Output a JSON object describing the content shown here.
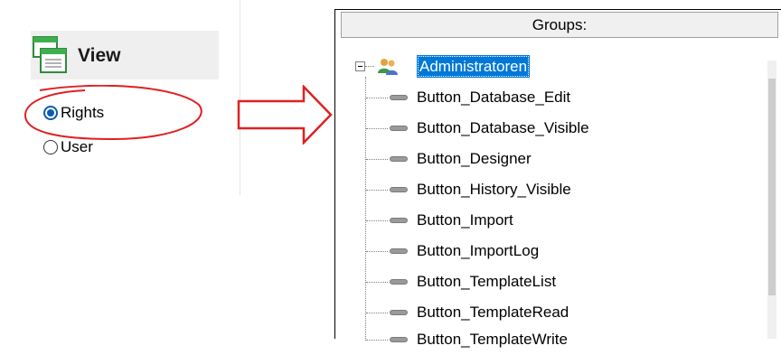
{
  "view_panel": {
    "title": "View",
    "icon": "view-window-icon",
    "options": [
      {
        "label": "Rights",
        "checked": true
      },
      {
        "label": "User",
        "checked": false
      }
    ],
    "highlight_color": "#e02020"
  },
  "arrow": {
    "icon": "right-arrow-icon",
    "color": "#e02020"
  },
  "groups_panel": {
    "header": "Groups:",
    "root": {
      "label": "Administratoren",
      "icon": "user-group-icon",
      "expanded": true,
      "selected": true
    },
    "items": [
      {
        "label": "Button_Database_Edit"
      },
      {
        "label": "Button_Database_Visible"
      },
      {
        "label": "Button_Designer"
      },
      {
        "label": "Button_History_Visible"
      },
      {
        "label": "Button_Import"
      },
      {
        "label": "Button_ImportLog"
      },
      {
        "label": "Button_TemplateList"
      },
      {
        "label": "Button_TemplateRead"
      },
      {
        "label": "Button_TemplateWrite"
      }
    ],
    "selection_color": "#0078d7"
  }
}
